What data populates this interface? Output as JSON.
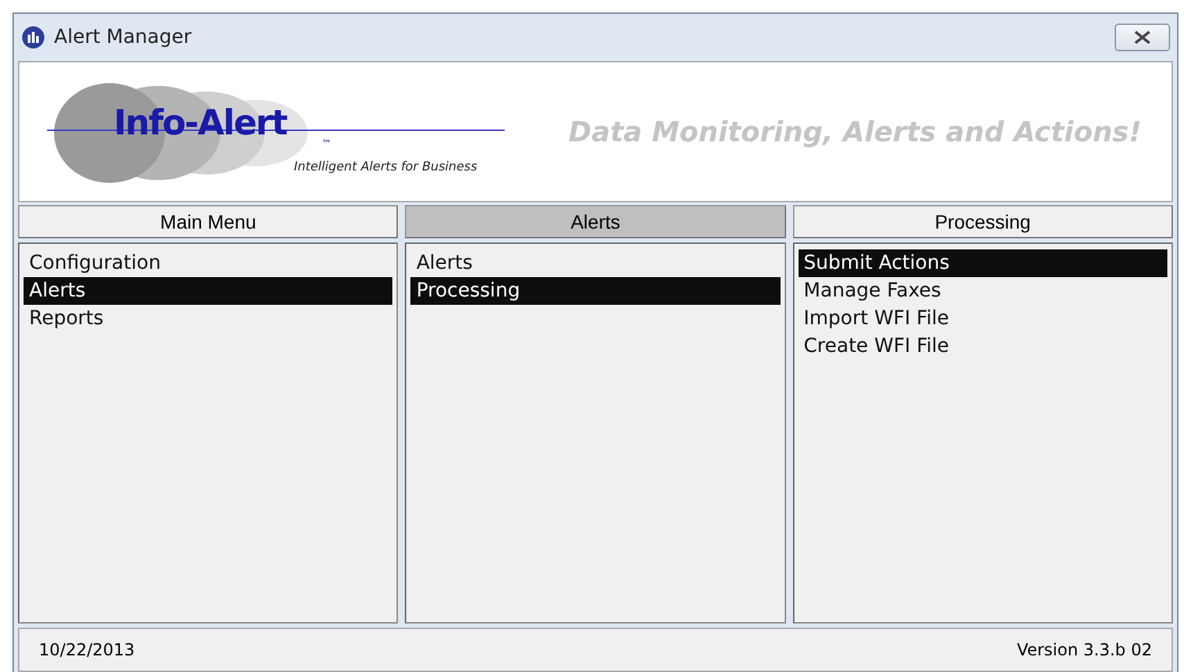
{
  "window": {
    "title": "Alert Manager"
  },
  "banner": {
    "logo_text": "Info-Alert",
    "logo_mark": "™",
    "logo_tagline": "Intelligent Alerts for Business",
    "slogan": "Data Monitoring, Alerts and Actions!"
  },
  "columns": [
    {
      "header": "Main Menu",
      "selected": false,
      "items": [
        {
          "label": "Configuration",
          "selected": false
        },
        {
          "label": "Alerts",
          "selected": true
        },
        {
          "label": "Reports",
          "selected": false
        }
      ]
    },
    {
      "header": "Alerts",
      "selected": true,
      "items": [
        {
          "label": "Alerts",
          "selected": false
        },
        {
          "label": "Processing",
          "selected": true
        }
      ]
    },
    {
      "header": "Processing",
      "selected": false,
      "items": [
        {
          "label": "Submit Actions",
          "selected": true
        },
        {
          "label": "Manage Faxes",
          "selected": false
        },
        {
          "label": "Import WFI File",
          "selected": false
        },
        {
          "label": "Create WFI File",
          "selected": false
        }
      ]
    }
  ],
  "status_bar": {
    "date": "10/22/2013",
    "version": "Version 3.3.b 02"
  }
}
